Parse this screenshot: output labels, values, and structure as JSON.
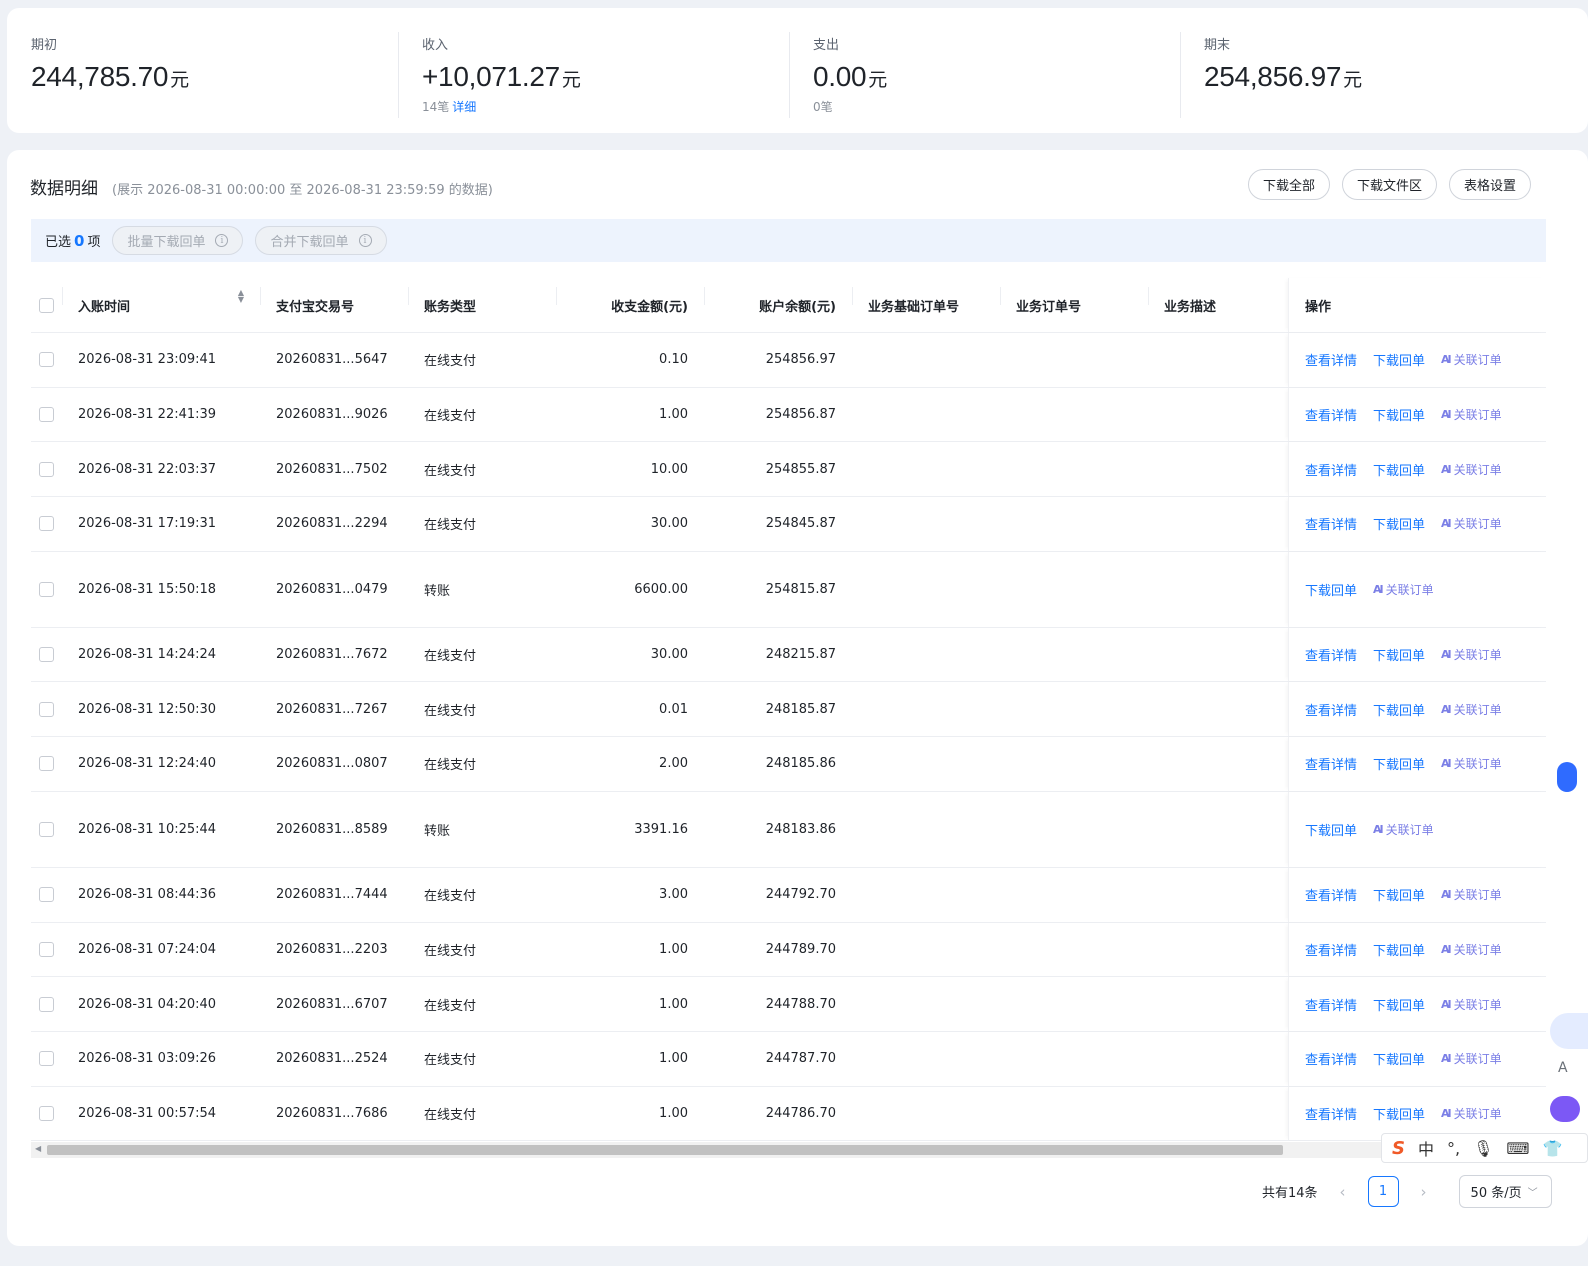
{
  "summary": [
    {
      "label": "期初",
      "value": "244,785.70",
      "unit": "元",
      "count": "",
      "link": ""
    },
    {
      "label": "收入",
      "value": "+10,071.27",
      "unit": "元",
      "count": "14笔",
      "link": "详细"
    },
    {
      "label": "支出",
      "value": "0.00",
      "unit": "元",
      "count": "0笔",
      "link": ""
    },
    {
      "label": "期末",
      "value": "254,856.97",
      "unit": "元",
      "count": "",
      "link": ""
    }
  ],
  "detail": {
    "title": "数据明细",
    "range": "(展示 2026-08-31 00:00:00 至 2026-08-31 23:59:59 的数据)",
    "buttons": [
      "下载全部",
      "下载文件区",
      "表格设置"
    ]
  },
  "selection": {
    "prefix": "已选",
    "count": "0",
    "suffix": "项",
    "batch_download": "批量下载回单",
    "merge_download": "合并下载回单",
    "info_icon": "i"
  },
  "table": {
    "headers": {
      "time": "入账时间",
      "trade_no": "支付宝交易号",
      "type": "账务类型",
      "amount": "收支金额(元)",
      "balance": "账户余额(元)",
      "base_order": "业务基础订单号",
      "order": "业务订单号",
      "desc": "业务描述",
      "ops": "操作"
    },
    "ops": {
      "view": "查看详情",
      "download": "下载回单",
      "related": "关联订单",
      "ai": "AI"
    },
    "rows": [
      {
        "time": "2026-08-31 23:09:41",
        "no": "20260831...5647",
        "type": "在线支付",
        "amount": "0.10",
        "balance": "254856.97",
        "view": true
      },
      {
        "time": "2026-08-31 22:41:39",
        "no": "20260831...9026",
        "type": "在线支付",
        "amount": "1.00",
        "balance": "254856.87",
        "view": true
      },
      {
        "time": "2026-08-31 22:03:37",
        "no": "20260831...7502",
        "type": "在线支付",
        "amount": "10.00",
        "balance": "254855.87",
        "view": true
      },
      {
        "time": "2026-08-31 17:19:31",
        "no": "20260831...2294",
        "type": "在线支付",
        "amount": "30.00",
        "balance": "254845.87",
        "view": true
      },
      {
        "time": "2026-08-31 15:50:18",
        "no": "20260831...0479",
        "type": "转账",
        "amount": "6600.00",
        "balance": "254815.87",
        "view": false
      },
      {
        "time": "2026-08-31 14:24:24",
        "no": "20260831...7672",
        "type": "在线支付",
        "amount": "30.00",
        "balance": "248215.87",
        "view": true
      },
      {
        "time": "2026-08-31 12:50:30",
        "no": "20260831...7267",
        "type": "在线支付",
        "amount": "0.01",
        "balance": "248185.87",
        "view": true
      },
      {
        "time": "2026-08-31 12:24:40",
        "no": "20260831...0807",
        "type": "在线支付",
        "amount": "2.00",
        "balance": "248185.86",
        "view": true
      },
      {
        "time": "2026-08-31 10:25:44",
        "no": "20260831...8589",
        "type": "转账",
        "amount": "3391.16",
        "balance": "248183.86",
        "view": false
      },
      {
        "time": "2026-08-31 08:44:36",
        "no": "20260831...7444",
        "type": "在线支付",
        "amount": "3.00",
        "balance": "244792.70",
        "view": true
      },
      {
        "time": "2026-08-31 07:24:04",
        "no": "20260831...2203",
        "type": "在线支付",
        "amount": "1.00",
        "balance": "244789.70",
        "view": true
      },
      {
        "time": "2026-08-31 04:20:40",
        "no": "20260831...6707",
        "type": "在线支付",
        "amount": "1.00",
        "balance": "244788.70",
        "view": true
      },
      {
        "time": "2026-08-31 03:09:26",
        "no": "20260831...2524",
        "type": "在线支付",
        "amount": "1.00",
        "balance": "244787.70",
        "view": true
      },
      {
        "time": "2026-08-31 00:57:54",
        "no": "20260831...7686",
        "type": "在线支付",
        "amount": "1.00",
        "balance": "244786.70",
        "view": true
      }
    ]
  },
  "pagination": {
    "total": "共有14条",
    "prev": "‹",
    "page": "1",
    "next": "›",
    "page_size": "50 条/页"
  },
  "ime": {
    "logo": "S",
    "mode": "中",
    "punct": "°,",
    "voice": "🎙",
    "keyboard": "⌨",
    "skin": "👕"
  },
  "edge": {
    "letter": "A"
  }
}
